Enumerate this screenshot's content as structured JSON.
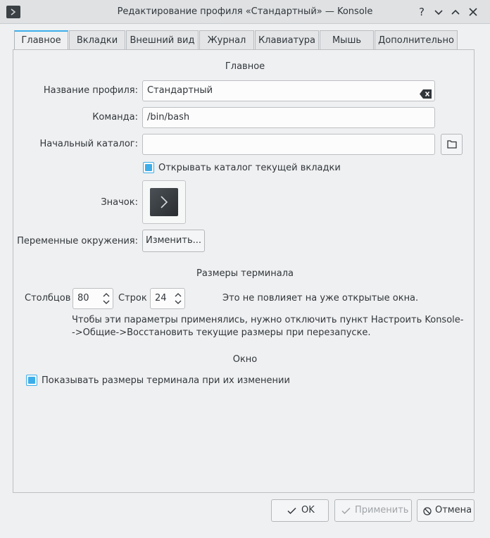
{
  "window": {
    "title": "Редактирование профиля «Стандартный» — Konsole"
  },
  "tabs": [
    {
      "label": "Главное",
      "active": true
    },
    {
      "label": "Вкладки"
    },
    {
      "label": "Внешний вид"
    },
    {
      "label": "Журнал"
    },
    {
      "label": "Клавиатура"
    },
    {
      "label": "Мышь"
    },
    {
      "label": "Дополнительно"
    }
  ],
  "general": {
    "section_title": "Главное",
    "profile_name_label": "Название профиля:",
    "profile_name_value": "Стандартный",
    "command_label": "Команда:",
    "command_value": "/bin/bash",
    "initial_dir_label": "Начальный каталог:",
    "initial_dir_value": "",
    "open_current_dir_label": "Открывать каталог текущей вкладки",
    "open_current_dir_checked": true,
    "icon_label": "Значок:",
    "env_label": "Переменные окружения:",
    "env_button": "Изменить..."
  },
  "terminal_size": {
    "section_title": "Размеры терминала",
    "columns_label": "Столбцов",
    "columns_value": "80",
    "rows_label": "Строк",
    "rows_value": "24",
    "note_open_windows": "Это не повлияет на уже открытые окна.",
    "note_line1": "Чтобы эти параметры применялись, нужно отключить пункт Настроить Konsole-",
    "note_line2": "->Общие->Восстановить текущие размеры при перезапуске."
  },
  "window_section": {
    "section_title": "Окно",
    "show_size_label": "Показывать размеры терминала при их изменении",
    "show_size_checked": true
  },
  "buttons": {
    "ok": "OK",
    "apply": "Применить",
    "cancel": "Отмена"
  },
  "colors": {
    "accent": "#3daee9",
    "background": "#eff0f1"
  }
}
